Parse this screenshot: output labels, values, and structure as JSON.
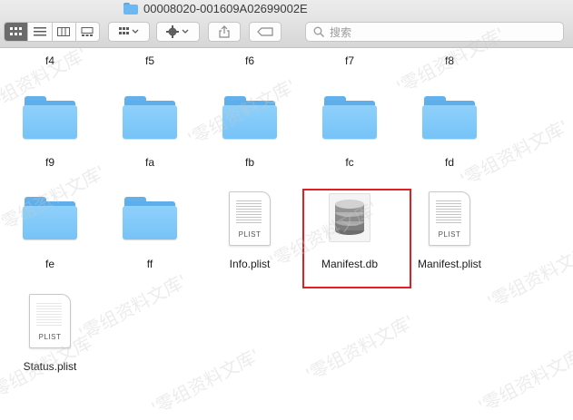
{
  "window": {
    "title": "00008020-001609A02699002E"
  },
  "toolbar": {
    "search_placeholder": "搜索"
  },
  "row0_labels": [
    "f4",
    "f5",
    "f6",
    "f7",
    "f8"
  ],
  "folders_row1": [
    "f9",
    "fa",
    "fb",
    "fc",
    "fd"
  ],
  "row2": {
    "folders": [
      "fe",
      "ff"
    ],
    "info_plist": {
      "name": "Info.plist",
      "tag": "PLIST"
    },
    "manifest_db": {
      "name": "Manifest.db"
    },
    "manifest_plist": {
      "name": "Manifest.plist",
      "tag": "PLIST"
    }
  },
  "row3": {
    "status_plist": {
      "name": "Status.plist",
      "tag": "PLIST"
    }
  },
  "watermark": "'零组资料文库'",
  "colors": {
    "selection_border": "#e02020",
    "folder": "#76c3f7"
  }
}
